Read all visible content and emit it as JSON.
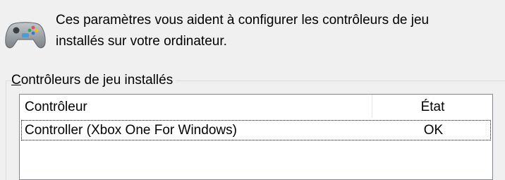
{
  "intro": {
    "text": "Ces paramètres vous aident à configurer les contrôleurs de jeu\ninstallés sur votre ordinateur.",
    "icon": "gamepad-icon"
  },
  "group": {
    "title_accel": "C",
    "title_rest": "ontrôleurs de jeu installés"
  },
  "list": {
    "columns": [
      "Contrôleur",
      "État"
    ],
    "rows": [
      {
        "name": "Controller (Xbox One For Windows)",
        "state": "OK"
      }
    ]
  }
}
